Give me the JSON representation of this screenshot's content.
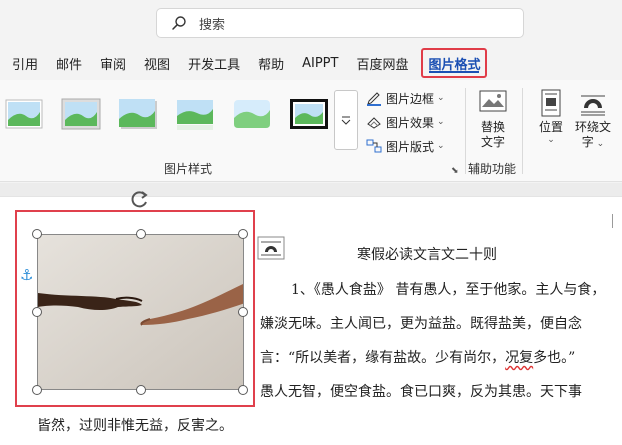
{
  "search": {
    "placeholder": "搜索"
  },
  "tabs": [
    "引用",
    "邮件",
    "审阅",
    "视图",
    "开发工具",
    "帮助",
    "AIPPT",
    "百度网盘",
    "图片格式"
  ],
  "ribbon": {
    "styles_group_label": "图片样式",
    "picture_border": "图片边框",
    "picture_effects": "图片效果",
    "picture_layout": "图片版式",
    "alt_text_line1": "替换",
    "alt_text_line2": "文字",
    "accessibility_group_label": "辅助功能",
    "position_label": "位置",
    "wrap_text_line1": "环绕文",
    "wrap_text_line2": "字"
  },
  "document": {
    "title": "寒假必读文言文二十则",
    "lines": [
      "1、《愚人食盐》 昔有愚人，至于他家。主人与食，",
      "嫌淡无味。主人闻已，更为益盐。既得盐美，便自念",
      "言：“所以美者，缘有盐故。少有尚尔，",
      "况复",
      "多也。”",
      "愚人无智，便空食盐。食已口爽，反为其患。天下事",
      "皆然，过则非惟无益，反害之。"
    ]
  },
  "colors": {
    "active_tab_text": "#1b4fb3",
    "selection_outline": "#e0404c",
    "anchor": "#2f8fd8"
  }
}
